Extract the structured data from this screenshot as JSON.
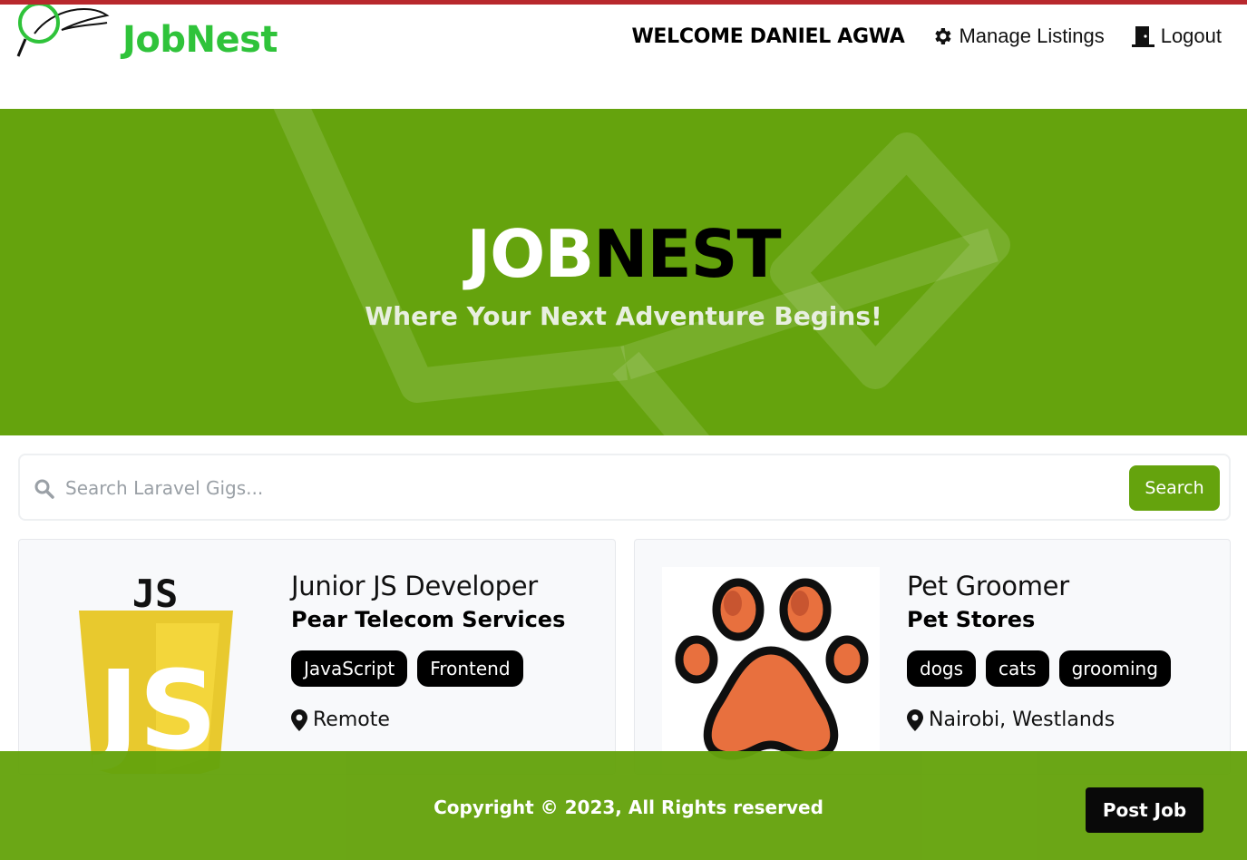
{
  "brand": {
    "name": "JobNest",
    "color": "#2fc33a"
  },
  "nav": {
    "welcome": "WELCOME DANIEL AGWA",
    "manage_label": "Manage Listings",
    "manage_icon": "gear-icon",
    "logout_label": "Logout",
    "logout_icon": "door-icon"
  },
  "hero": {
    "title_part1": "JOB",
    "title_part2": "NEST",
    "subtitle": "Where Your Next Adventure Begins!",
    "background": "#65a30d"
  },
  "search": {
    "placeholder": "Search Laravel Gigs...",
    "button_label": "Search",
    "icon": "search-icon"
  },
  "listings": [
    {
      "title": "Junior JS Developer",
      "company": "Pear Telecom Services",
      "tags": [
        "JavaScript",
        "Frontend"
      ],
      "location": "Remote",
      "logo": "js-logo"
    },
    {
      "title": "Pet Groomer",
      "company": "Pet Stores",
      "tags": [
        "dogs",
        "cats",
        "grooming"
      ],
      "location": "Nairobi, Westlands",
      "logo": "paw-logo"
    }
  ],
  "footer": {
    "copyright": "Copyright © 2023, All Rights reserved",
    "post_label": "Post Job"
  },
  "colors": {
    "accent": "#65a30d",
    "topline": "#b8282d",
    "tag": "#000000"
  }
}
